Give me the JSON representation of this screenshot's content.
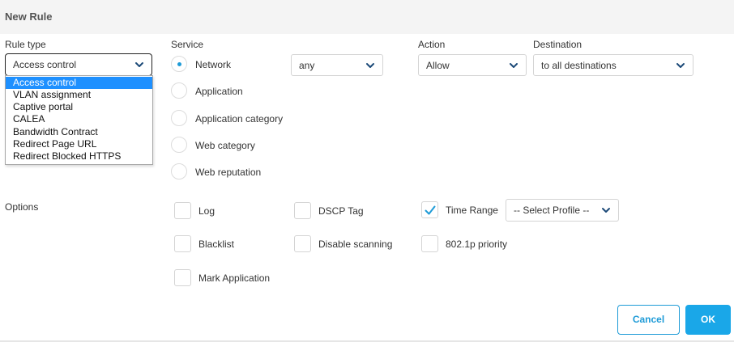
{
  "header": {
    "title": "New Rule"
  },
  "rule_type": {
    "label": "Rule type",
    "selected": "Access control",
    "options": [
      "Access control",
      "VLAN assignment",
      "Captive portal",
      "CALEA",
      "Bandwidth Contract",
      "Redirect Page URL",
      "Redirect Blocked HTTPS"
    ]
  },
  "service": {
    "label": "Service",
    "network_select": "any",
    "options": [
      {
        "label": "Network",
        "checked": true
      },
      {
        "label": "Application",
        "checked": false
      },
      {
        "label": "Application category",
        "checked": false
      },
      {
        "label": "Web category",
        "checked": false
      },
      {
        "label": "Web reputation",
        "checked": false
      }
    ]
  },
  "action": {
    "label": "Action",
    "selected": "Allow"
  },
  "destination": {
    "label": "Destination",
    "selected": "to all destinations"
  },
  "options": {
    "label": "Options",
    "log": {
      "label": "Log",
      "checked": false
    },
    "blacklist": {
      "label": "Blacklist",
      "checked": false
    },
    "mark_application": {
      "label": "Mark Application",
      "checked": false
    },
    "dscp_tag": {
      "label": "DSCP Tag",
      "checked": false
    },
    "disable_scanning": {
      "label": "Disable scanning",
      "checked": false
    },
    "time_range": {
      "label": "Time Range",
      "checked": true,
      "profile": "-- Select Profile --"
    },
    "priority": {
      "label": "802.1p priority",
      "checked": false
    }
  },
  "buttons": {
    "cancel": "Cancel",
    "ok": "OK"
  },
  "colors": {
    "accent": "#1aa7e8",
    "chevron": "#1c4a78",
    "selection": "#1e90ff"
  }
}
